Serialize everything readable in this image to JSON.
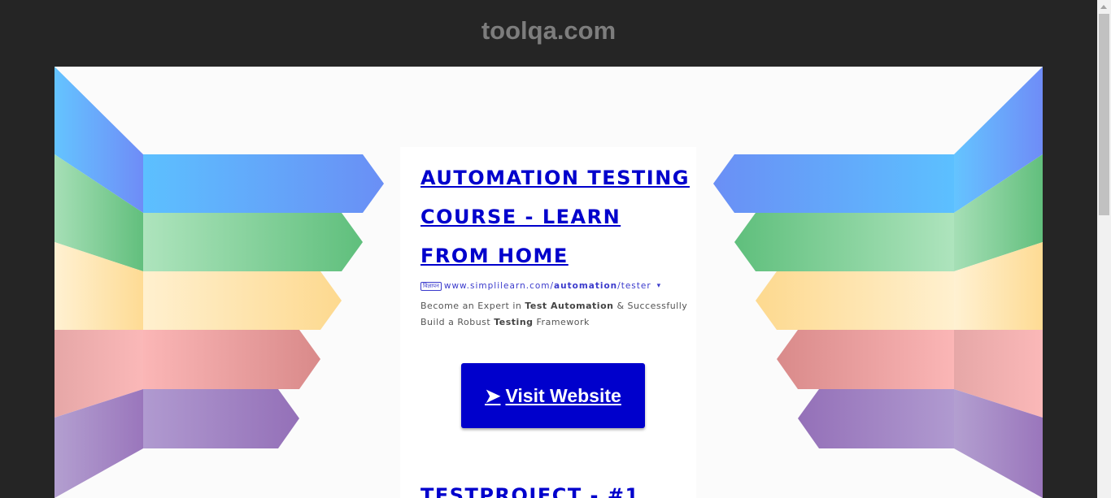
{
  "header": {
    "site_name": "toolqa.com"
  },
  "ad": {
    "title": "AUTOMATION TESTING COURSE - LEARN FROM HOME",
    "badge": "विज्ञापन",
    "url_prefix": "www.simplilearn.com/",
    "url_bold": "automation",
    "url_suffix": "/tester",
    "caret": "▾",
    "description": {
      "part1": "Become an Expert in ",
      "bold1": "Test Automation",
      "part2": " & Successfully Build a Robust ",
      "bold2": "Testing",
      "part3": " Framework"
    },
    "button": {
      "arrow": "➤",
      "label": "Visit Website"
    }
  },
  "ad2": {
    "title": "TESTPROJECT - #1"
  },
  "colors": {
    "background": "#252525",
    "link_blue": "#0000cc",
    "stripe_colors": [
      "#5fb9ff",
      "#75c98a",
      "#fde0a0",
      "#e49a9a",
      "#9c78bd"
    ]
  }
}
